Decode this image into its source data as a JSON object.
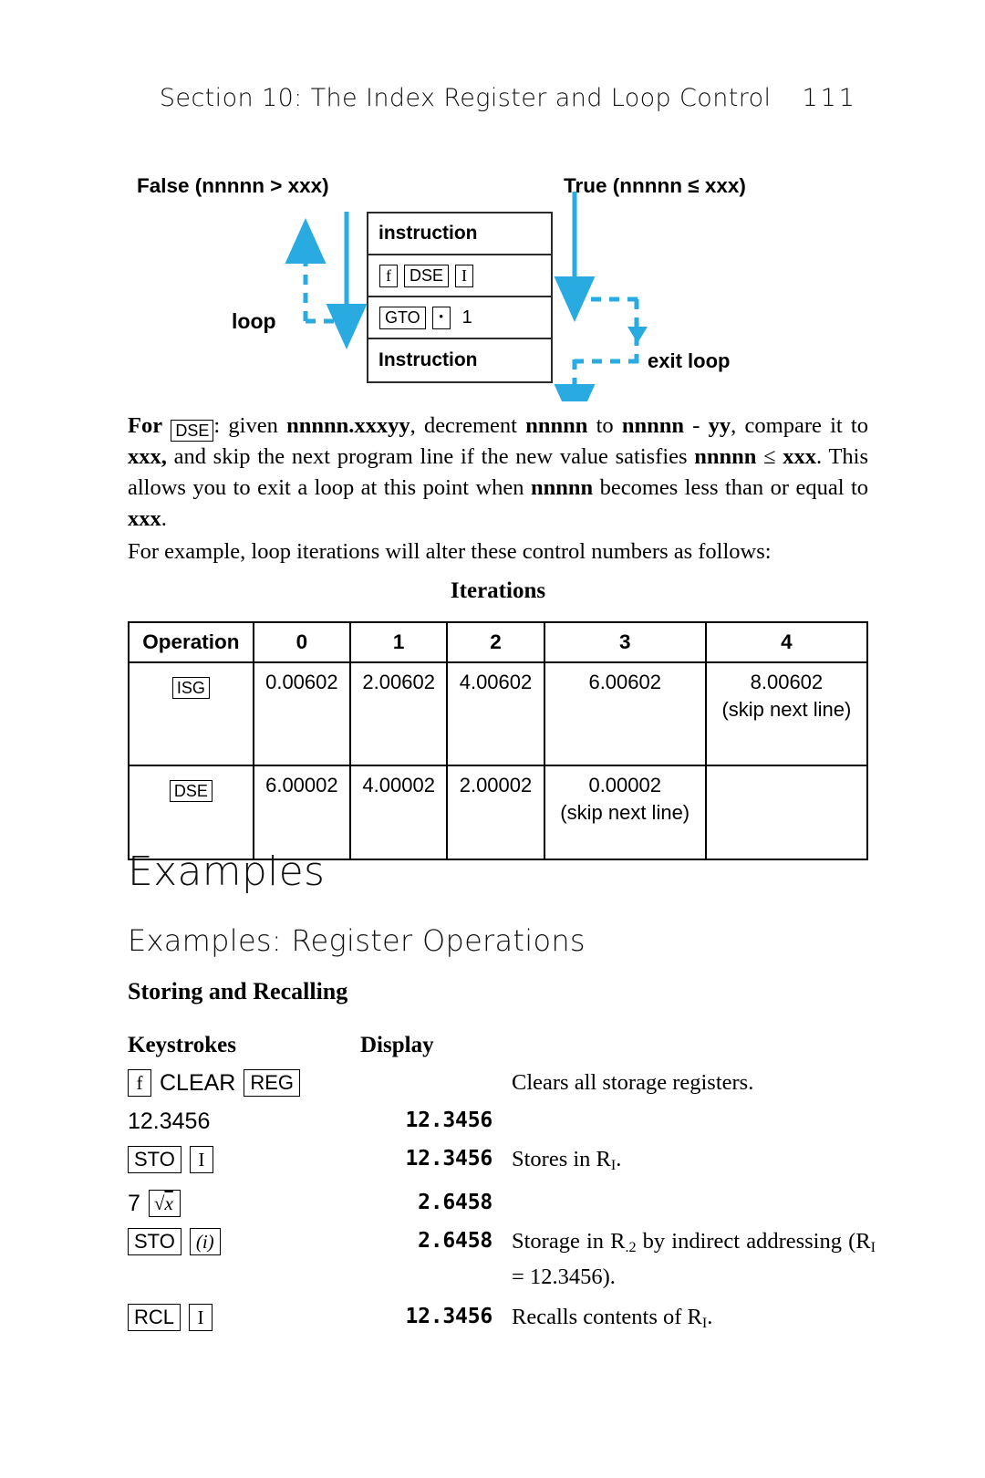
{
  "header": {
    "title": "Section 10: The Index Register and Loop Control",
    "page_number": "111"
  },
  "diagram": {
    "label_false": "False (nnnnn > xxx)",
    "label_true": "True (nnnnn ≤ xxx)",
    "label_loop": "loop",
    "label_exit": "exit loop",
    "accent_color": "#29ABE2",
    "rows": {
      "row1": "instruction",
      "row2_keys": [
        "f",
        "DSE",
        "I"
      ],
      "row3_keys": [
        "GTO",
        "•"
      ],
      "row3_number": "1",
      "row4": "Instruction"
    }
  },
  "paragraphs": {
    "dse": {
      "lead": "For",
      "key": "DSE",
      "t1": ": given ",
      "b1": "nnnnn.xxxyy",
      "t2": ", decrement ",
      "b2": "nnnnn",
      "t3": " to ",
      "b3": "nnnnn",
      "t4": " - ",
      "b4": "yy",
      "t5": ", compare it to ",
      "b5": "xxx,",
      "t6": " and skip the next program line if the new value satisfies ",
      "b6": "nnnnn",
      "t7": " ≤ ",
      "b7": "xxx",
      "t8": ". This allows you to exit a loop at this point when ",
      "b8": "nnnnn",
      "t9": " becomes less than or equal to ",
      "b9": "xxx",
      "t10": "."
    },
    "example_intro": "For example, loop iterations will alter these control numbers as follows:"
  },
  "iterations_table": {
    "title": "Iterations",
    "columns": [
      "Operation",
      "0",
      "1",
      "2",
      "3",
      "4"
    ],
    "rows": [
      {
        "operation": "ISG",
        "values": [
          "0.00602",
          "2.00602",
          "4.00602",
          "6.00602",
          "8.00602"
        ],
        "notes": [
          "",
          "",
          "",
          "",
          "(skip next line)"
        ]
      },
      {
        "operation": "DSE",
        "values": [
          "6.00002",
          "4.00002",
          "2.00002",
          "0.00002",
          ""
        ],
        "notes": [
          "",
          "",
          "",
          "(skip next line)",
          ""
        ]
      }
    ]
  },
  "headings": {
    "examples": "Examples",
    "examples_register_operations": "Examples: Register Operations",
    "storing_and_recalling": "Storing and Recalling"
  },
  "keystrokes_table": {
    "col_keystrokes": "Keystrokes",
    "col_display": "Display",
    "rows": [
      {
        "keys": [
          {
            "type": "key",
            "label": "f",
            "style": "serif"
          },
          {
            "type": "plain",
            "label": "CLEAR"
          },
          {
            "type": "key",
            "label": "REG",
            "style": "sans"
          }
        ],
        "display": "",
        "desc": "Clears all storage registers."
      },
      {
        "keys": [
          {
            "type": "plain",
            "label": "12.3456"
          }
        ],
        "display": "12.3456",
        "desc": ""
      },
      {
        "keys": [
          {
            "type": "key",
            "label": "STO",
            "style": "sans"
          },
          {
            "type": "key",
            "label": "I",
            "style": "serif"
          }
        ],
        "display": "12.3456",
        "desc": "Stores in Rᴵ."
      },
      {
        "keys": [
          {
            "type": "plain",
            "label": "7"
          },
          {
            "type": "key",
            "label": "√x",
            "style": "sqrt"
          }
        ],
        "display": "2.6458",
        "desc": ""
      },
      {
        "keys": [
          {
            "type": "key",
            "label": "STO",
            "style": "sans"
          },
          {
            "type": "key",
            "label": "(i)",
            "style": "ital"
          }
        ],
        "display": "2.6458",
        "desc": "Storage in R.2 by indirect addressing (RI = 12.3456)."
      },
      {
        "keys": [
          {
            "type": "key",
            "label": "RCL",
            "style": "sans"
          },
          {
            "type": "key",
            "label": "I",
            "style": "serif"
          }
        ],
        "display": "12.3456",
        "desc": "Recalls contents of RI."
      }
    ]
  }
}
